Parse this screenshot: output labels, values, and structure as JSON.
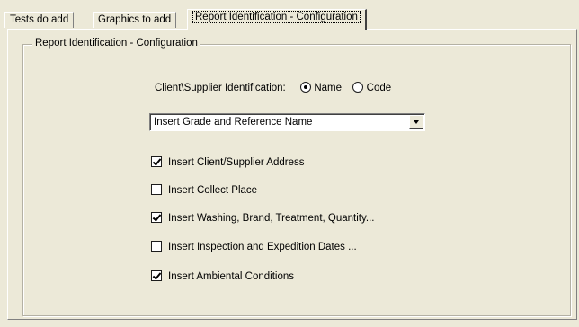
{
  "tabs": [
    {
      "label": "Tests do add"
    },
    {
      "label": "Graphics to add"
    },
    {
      "label": "Report Identification - Configuration"
    }
  ],
  "group": {
    "title": "Report Identification - Configuration"
  },
  "identification": {
    "label": "Client\\Supplier Identification:",
    "options": [
      {
        "label": "Name",
        "selected": true
      },
      {
        "label": "Code",
        "selected": false
      }
    ]
  },
  "dropdown": {
    "value": "Insert Grade and Reference Name"
  },
  "checkboxes": [
    {
      "label": "Insert Client/Supplier Address",
      "checked": true
    },
    {
      "label": "Insert Collect Place",
      "checked": false
    },
    {
      "label": "Insert Washing, Brand, Treatment, Quantity...",
      "checked": true
    },
    {
      "label": "Insert Inspection and Expedition Dates ...",
      "checked": false
    },
    {
      "label": "Insert Ambiental Conditions",
      "checked": true
    }
  ]
}
